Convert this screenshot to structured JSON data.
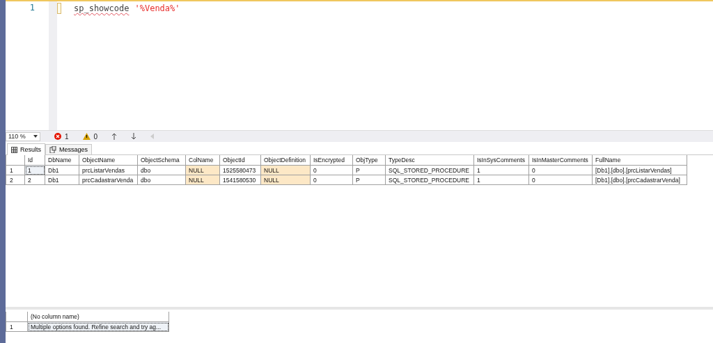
{
  "editor": {
    "lines": [
      {
        "number": "1",
        "tokens": [
          {
            "kind": "keyword",
            "text": "sp_showcode"
          },
          {
            "kind": "string",
            "text": "'%Venda%'"
          }
        ]
      }
    ]
  },
  "status_bar": {
    "zoom": "110 %",
    "errors": "1",
    "warnings": "0"
  },
  "tabs": [
    {
      "label": "Results",
      "selected": true
    },
    {
      "label": "Messages",
      "selected": false
    }
  ],
  "results": [
    {
      "columns": [
        "Id",
        "DbName",
        "ObjectName",
        "ObjectSchema",
        "ColName",
        "ObjectId",
        "ObjectDefinition",
        "IsEncrypted",
        "ObjType",
        "TypeDesc",
        "IsInSysComments",
        "IsInMasterComments",
        "FullName"
      ],
      "rows": [
        {
          "number": "1",
          "cells": [
            {
              "text": "1",
              "focused": true,
              "null": false
            },
            {
              "text": "Db1",
              "focused": false,
              "null": false
            },
            {
              "text": "prcListarVendas",
              "focused": false,
              "null": false
            },
            {
              "text": "dbo",
              "focused": false,
              "null": false
            },
            {
              "text": "NULL",
              "focused": false,
              "null": true
            },
            {
              "text": "1525580473",
              "focused": false,
              "null": false
            },
            {
              "text": "NULL",
              "focused": false,
              "null": true
            },
            {
              "text": "0",
              "focused": false,
              "null": false
            },
            {
              "text": "P",
              "focused": false,
              "null": false
            },
            {
              "text": "SQL_STORED_PROCEDURE",
              "focused": false,
              "null": false
            },
            {
              "text": "1",
              "focused": false,
              "null": false
            },
            {
              "text": "0",
              "focused": false,
              "null": false
            },
            {
              "text": "[Db1].[dbo].[prcListarVendas]",
              "focused": false,
              "null": false
            }
          ]
        },
        {
          "number": "2",
          "cells": [
            {
              "text": "2",
              "focused": false,
              "null": false
            },
            {
              "text": "Db1",
              "focused": false,
              "null": false
            },
            {
              "text": "prcCadastrarVenda",
              "focused": false,
              "null": false
            },
            {
              "text": "dbo",
              "focused": false,
              "null": false
            },
            {
              "text": "NULL",
              "focused": false,
              "null": true
            },
            {
              "text": "1541580530",
              "focused": false,
              "null": false
            },
            {
              "text": "NULL",
              "focused": false,
              "null": true
            },
            {
              "text": "0",
              "focused": false,
              "null": false
            },
            {
              "text": "P",
              "focused": false,
              "null": false
            },
            {
              "text": "SQL_STORED_PROCEDURE",
              "focused": false,
              "null": false
            },
            {
              "text": "1",
              "focused": false,
              "null": false
            },
            {
              "text": "0",
              "focused": false,
              "null": false
            },
            {
              "text": "[Db1].[dbo].[prcCadastrarVenda]",
              "focused": false,
              "null": false
            }
          ]
        }
      ]
    },
    {
      "columns": [
        "(No column name)"
      ],
      "rows": [
        {
          "number": "1",
          "cells": [
            {
              "text": "Multiple options found. Refine search and try ag...",
              "focused": true,
              "null": false
            }
          ]
        }
      ]
    }
  ]
}
